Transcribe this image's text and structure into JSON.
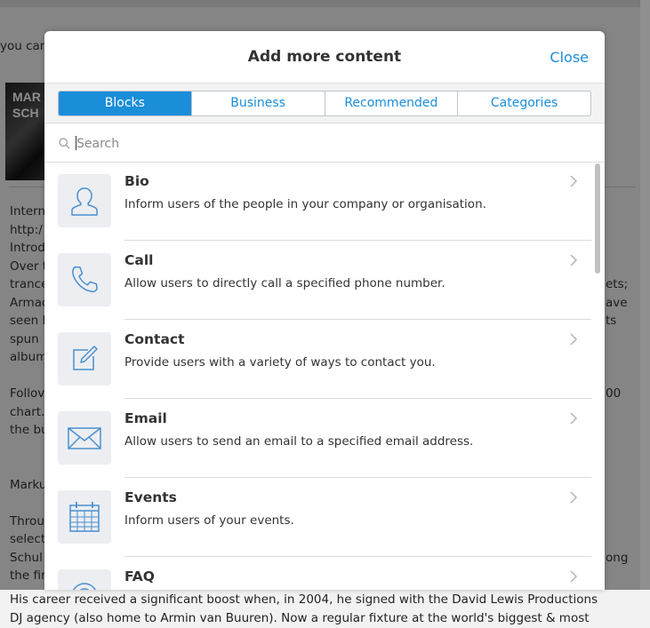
{
  "background": {
    "partial_top": "you can",
    "thumbnail_text": [
      "MAR",
      "SCH"
    ],
    "lines": [
      {
        "left": "Intern",
        "right": ""
      },
      {
        "left": "http:/",
        "right": ""
      },
      {
        "left": "Introd",
        "right": ""
      },
      {
        "left": "Over t",
        "right": ""
      },
      {
        "left": "trance",
        "right": "ets;"
      },
      {
        "left": "Armad",
        "right": "ave"
      },
      {
        "left": "seen l",
        "right": "ts"
      },
      {
        "left": "spun",
        "right": ""
      },
      {
        "left": "album",
        "right": ""
      },
      {
        "left": "",
        "right": ""
      },
      {
        "left": "Follov",
        "right": "00"
      },
      {
        "left": "chart.",
        "right": ""
      },
      {
        "left": "the bu",
        "right": ""
      },
      {
        "left": "",
        "right": ""
      },
      {
        "left": "",
        "right": ""
      },
      {
        "left": "Marku",
        "right": ""
      },
      {
        "left": "",
        "right": ""
      },
      {
        "left": "Throu",
        "right": ""
      },
      {
        "left": "select",
        "right": ""
      },
      {
        "left": "Schul",
        "right": "ong"
      },
      {
        "left": "the fir",
        "right": ""
      }
    ],
    "bottom_lines": [
      "His career received a significant boost when, in 2004, he signed with the David Lewis Productions",
      "DJ agency (also home to Armin van Buuren). Now a regular fixture at the world's biggest & most"
    ]
  },
  "modal": {
    "title": "Add more content",
    "close_label": "Close",
    "tabs": [
      {
        "label": "Blocks",
        "active": true
      },
      {
        "label": "Business",
        "active": false
      },
      {
        "label": "Recommended",
        "active": false
      },
      {
        "label": "Categories",
        "active": false
      }
    ],
    "search": {
      "placeholder": "Search",
      "value": ""
    },
    "items": [
      {
        "title": "Bio",
        "description": "Inform users of the people in your company or organisation.",
        "icon": "person-icon"
      },
      {
        "title": "Call",
        "description": "Allow users to directly call a specified phone number.",
        "icon": "phone-icon"
      },
      {
        "title": "Contact",
        "description": "Provide users with a variety of ways to contact you.",
        "icon": "edit-icon"
      },
      {
        "title": "Email",
        "description": "Allow users to send an email to a specified email address.",
        "icon": "envelope-icon"
      },
      {
        "title": "Events",
        "description": "Inform users of your events.",
        "icon": "calendar-icon"
      },
      {
        "title": "FAQ",
        "description": "",
        "icon": "faq-icon"
      }
    ]
  },
  "colors": {
    "accent": "#1a8ed9",
    "icon_stroke": "#4a8fd0",
    "icon_bg": "#eceef1"
  }
}
